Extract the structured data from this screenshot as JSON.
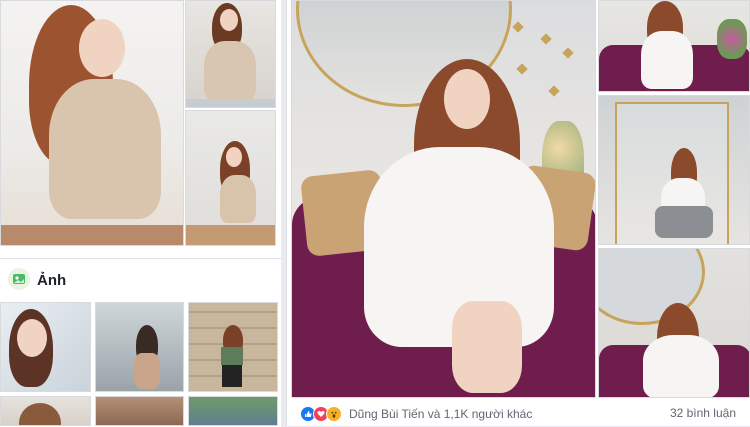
{
  "photos_section": {
    "title": "Ảnh"
  },
  "post": {
    "reaction_icons": [
      "like-icon",
      "love-icon",
      "wow-icon"
    ],
    "reactions_text": "Dũng Bùi Tiến và 1,1K người khác",
    "comments_text": "32 bình luận"
  },
  "colors": {
    "page_bg": "#e9ebee",
    "card_bg": "#ffffff",
    "like_blue": "#1877f2",
    "love_red": "#f33e58",
    "wow_yellow": "#f7b125",
    "sofa_purple": "#6e1d4d"
  }
}
